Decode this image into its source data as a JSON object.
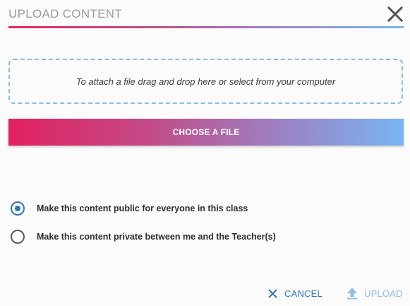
{
  "dialog": {
    "title": "UPLOAD CONTENT",
    "close_icon": "close-icon"
  },
  "dropzone": {
    "text": "To attach a file drag and drop here or select from your computer"
  },
  "choose_button": {
    "label": "CHOOSE A FILE"
  },
  "visibility": {
    "options": [
      {
        "label": "Make this content public for everyone in this class",
        "selected": true
      },
      {
        "label": "Make this content private between me and the Teacher(s)",
        "selected": false
      }
    ]
  },
  "footer": {
    "cancel_label": "CANCEL",
    "upload_label": "UPLOAD",
    "cancel_icon": "close-icon",
    "upload_icon": "upload-arrow-icon"
  },
  "colors": {
    "accent_blue": "#2f76b8",
    "disabled_blue": "#8fbcea",
    "gradient_start": "#e3205f",
    "gradient_end": "#79b5f3"
  }
}
